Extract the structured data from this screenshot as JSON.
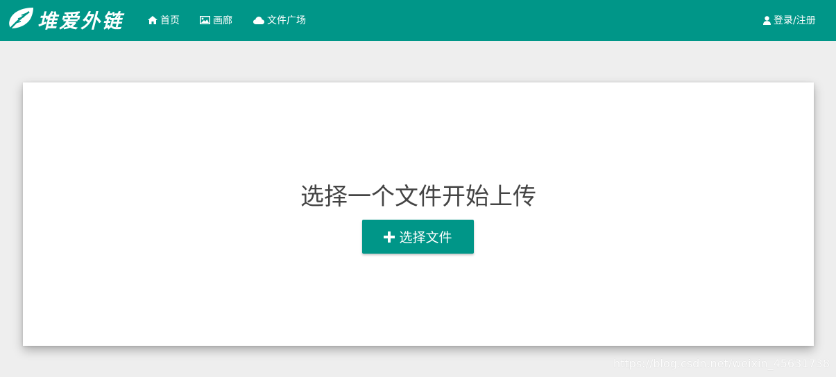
{
  "header": {
    "logo_text": "堆爱外链",
    "nav": [
      {
        "label": "首页",
        "icon": "home-icon"
      },
      {
        "label": "画廊",
        "icon": "image-icon"
      },
      {
        "label": "文件广场",
        "icon": "cloud-icon"
      }
    ],
    "login": {
      "label": "登录/注册",
      "icon": "user-icon"
    }
  },
  "upload": {
    "headline": "选择一个文件开始上传",
    "button_label": "选择文件",
    "button_icon": "plus-icon"
  },
  "watermark": "https://blog.csdn.net/weixin_45631738",
  "colors": {
    "primary": "#009688",
    "page_background": "#eeeeee",
    "card_background": "#ffffff",
    "headline_text": "#444444"
  }
}
